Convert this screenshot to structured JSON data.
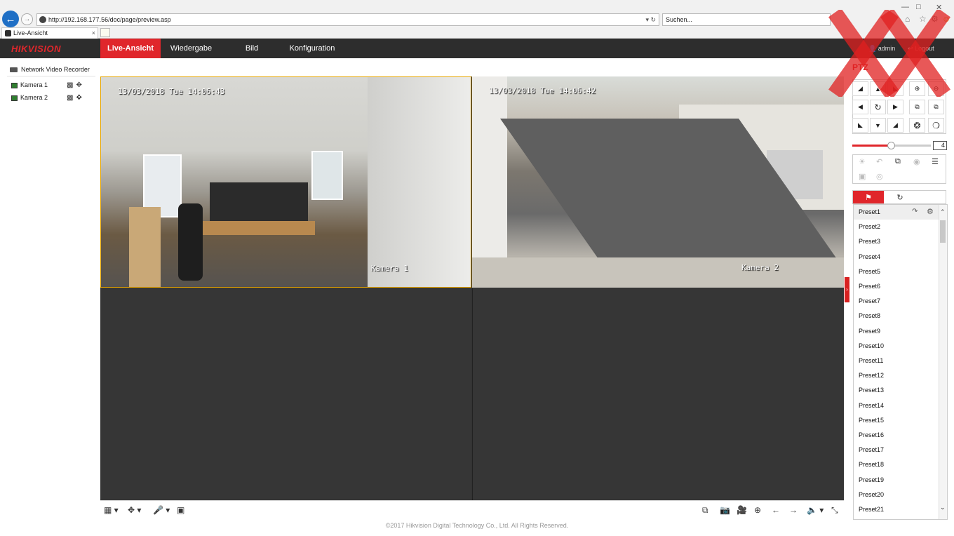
{
  "browser": {
    "url": "http://192.168.177.56/doc/page/preview.asp",
    "search_placeholder": "Suchen...",
    "tab_title": "Live-Ansicht"
  },
  "app": {
    "logo": "HIKVISION",
    "menu": [
      "Live-Ansicht",
      "Wiedergabe",
      "Bild",
      "Konfiguration"
    ],
    "active_menu": "Live-Ansicht",
    "user": "admin",
    "logout": "Logout",
    "accent_color": "#e0262b"
  },
  "tree": {
    "root": "Network Video Recorder",
    "cameras": [
      "Kamera 1",
      "Kamera 2"
    ]
  },
  "views": [
    {
      "timestamp": "13/03/2018 Tue 14:06:43",
      "label": "Kamera 1"
    },
    {
      "timestamp": "13/03/2018 Tue 14:06:42",
      "label": "Kamera 2"
    }
  ],
  "ptz": {
    "title": "PTZ",
    "speed": "4",
    "presets": [
      "Preset1",
      "Preset2",
      "Preset3",
      "Preset4",
      "Preset5",
      "Preset6",
      "Preset7",
      "Preset8",
      "Preset9",
      "Preset10",
      "Preset11",
      "Preset12",
      "Preset13",
      "Preset14",
      "Preset15",
      "Preset16",
      "Preset17",
      "Preset18",
      "Preset19",
      "Preset20",
      "Preset21"
    ]
  },
  "footer": "©2017 Hikvision Digital Technology Co., Ltd. All Rights Reserved."
}
